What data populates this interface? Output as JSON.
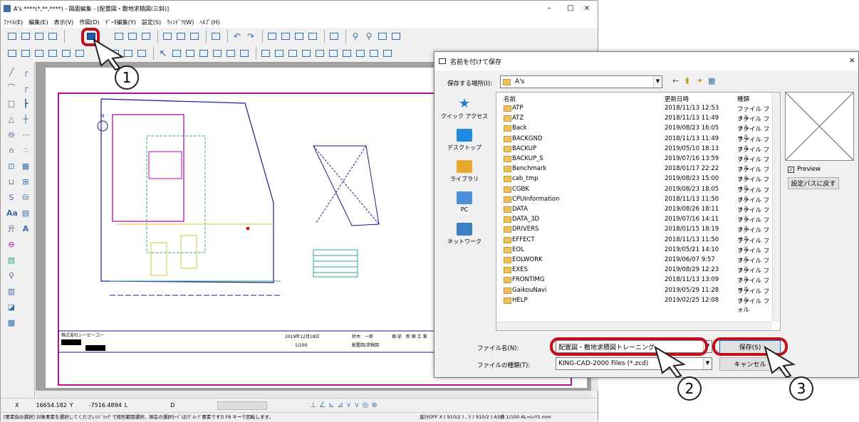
{
  "cad_window": {
    "title": "A's ****(*,**,****) - 図面編集 - [配置図・敷地求積図(三斜)]",
    "minimize": "–",
    "maximize": "□",
    "close": "×",
    "menu": [
      "ﾌｧｲﾙ(E)",
      "編集(E)",
      "表示(V)",
      "作図(D)",
      "ﾃﾞｰﾀ編集(Y)",
      "設定(S)",
      "ｳｨﾝﾄﾞｳ(W)",
      "ﾍﾙﾌﾟ(H)"
    ],
    "coord": {
      "x_label": "X",
      "x_value": "16654.182",
      "y_label": "Y",
      "y_value": "-7516.4894",
      "l_label": "L",
      "d_label": "D"
    },
    "status": "[要素指示選択]  対象要素を選択してください(ﾄﾞﾗｯｸﾞで矩形範囲選択、現在の選択ﾓｰﾄﾞは[ｸﾞﾙｰﾌﾟ要素です])  F8  キーで回転します。",
    "status_right": "直行OFF   X ( 910/2 ) , Y ( 910/2 )   A3横   1/100   AL=ﾚｲﾔ1   mm",
    "drawing": {
      "company": "株式会社シーピーユー",
      "date": "2019年12月18日",
      "scale": "1/100",
      "drawing_name": "配置図/求積図",
      "person": "鈴木　一郎",
      "person_label": "様 邸　新 築 工 事",
      "north": "N"
    }
  },
  "dialog": {
    "title": "名前を付けて保存",
    "close": "×",
    "save_in_label": "保存する場所(I):",
    "save_in_value": "A's",
    "places": [
      {
        "label": "クイック アクセス",
        "color": "#1e7bd8"
      },
      {
        "label": "デスクトップ",
        "color": "#1f8ae0"
      },
      {
        "label": "ライブラリ",
        "color": "#e8a92e"
      },
      {
        "label": "PC",
        "color": "#4a90d9"
      },
      {
        "label": "ネットワーク",
        "color": "#3b7fc4"
      }
    ],
    "columns": {
      "name": "名前",
      "date": "更新日時",
      "type": "種類"
    },
    "files": [
      {
        "name": "ATP",
        "date": "2018/11/13 12:53",
        "type": "ファイル フォル"
      },
      {
        "name": "ATZ",
        "date": "2018/11/13 11:49",
        "type": "ファイル フォル"
      },
      {
        "name": "Back",
        "date": "2019/08/23 16:05",
        "type": "ファイル フォル"
      },
      {
        "name": "BACKGND",
        "date": "2018/11/13 11:49",
        "type": "ファイル フォル"
      },
      {
        "name": "BACKUP",
        "date": "2019/05/10 18:13",
        "type": "ファイル フォル"
      },
      {
        "name": "BACKUP_S",
        "date": "2019/07/16 13:59",
        "type": "ファイル フォル"
      },
      {
        "name": "Benchmark",
        "date": "2018/01/17 22:22",
        "type": "ファイル フォル"
      },
      {
        "name": "cab_tmp",
        "date": "2019/08/23 15:00",
        "type": "ファイル フォル"
      },
      {
        "name": "CGBK",
        "date": "2019/08/23 18:05",
        "type": "ファイル フォル"
      },
      {
        "name": "CPUInformation",
        "date": "2018/11/13 11:50",
        "type": "ファイル フォル"
      },
      {
        "name": "DATA",
        "date": "2019/08/26 18:11",
        "type": "ファイル フォル"
      },
      {
        "name": "DATA_3D",
        "date": "2019/07/16 14:11",
        "type": "ファイル フォル"
      },
      {
        "name": "DRIVERS",
        "date": "2018/01/15 18:19",
        "type": "ファイル フォル"
      },
      {
        "name": "EFFECT",
        "date": "2018/11/13 11:50",
        "type": "ファイル フォル"
      },
      {
        "name": "EOL",
        "date": "2019/05/21 14:10",
        "type": "ファイル フォル"
      },
      {
        "name": "EOLWORK",
        "date": "2019/06/07 9:57",
        "type": "ファイル フォル"
      },
      {
        "name": "EXES",
        "date": "2019/08/29 12:23",
        "type": "ファイル フォル"
      },
      {
        "name": "FRONTIMG",
        "date": "2018/11/13 13:09",
        "type": "ファイル フォル"
      },
      {
        "name": "GaikouNavi",
        "date": "2019/05/29 11:28",
        "type": "ファイル フォル"
      },
      {
        "name": "HELP",
        "date": "2019/02/25 12:08",
        "type": "ファイル フォル"
      }
    ],
    "preview_label": "Preview",
    "reset_button": "設定パスに戻す",
    "filename_label": "ファイル名(N):",
    "filename_value": "配置図・敷地求積図トレーニング",
    "filetype_label": "ファイルの種類(T):",
    "filetype_value": "KING-CAD-2000 Files (*.zcd)",
    "save_button": "保存(S)",
    "cancel_button": "キャンセル"
  },
  "callouts": [
    "1",
    "2",
    "3"
  ],
  "colors": {
    "highlight": "#c0101e",
    "magenta": "#b0109a",
    "cyan": "#3aa0a0",
    "navy": "#1a1a8a"
  }
}
